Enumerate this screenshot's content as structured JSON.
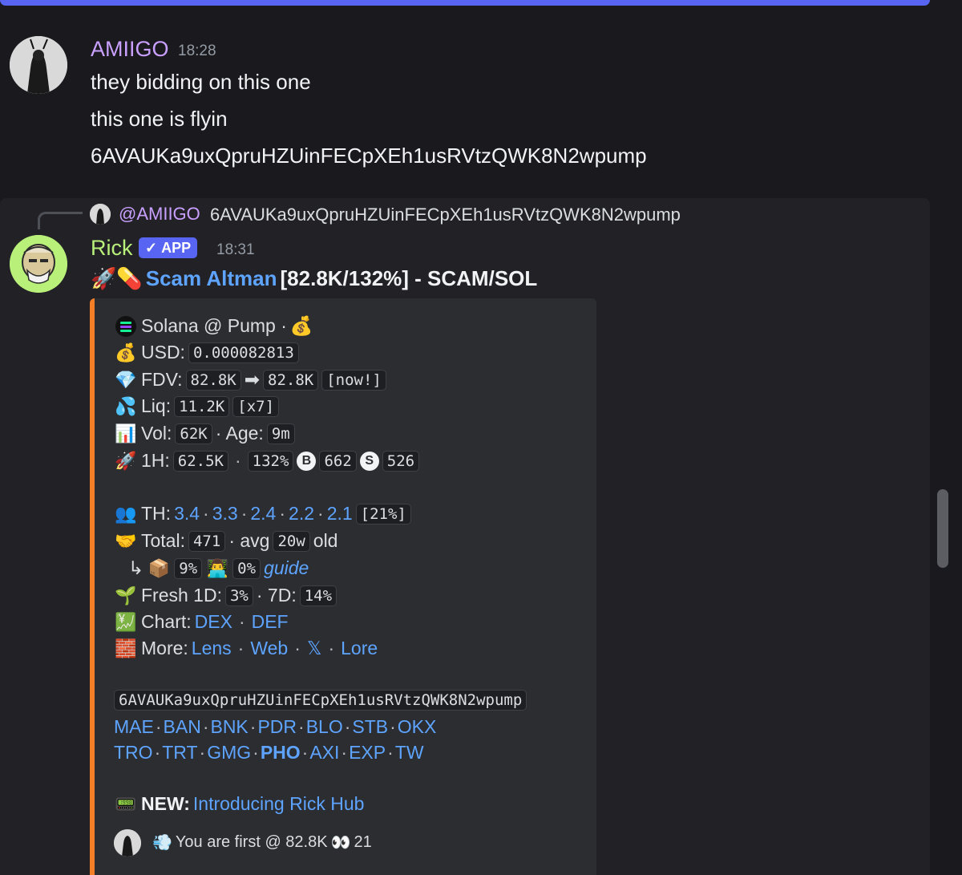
{
  "message1": {
    "username": "AMIIGO",
    "time": "18:28",
    "lines": [
      "they bidding on this one",
      "this one is flyin",
      "6AVAUKa9uxQpruHZUinFECpXEh1usRVtzQWK8N2wpump"
    ]
  },
  "reply": {
    "mention": "@AMIIGO",
    "text": "6AVAUKa9uxQpruHZUinFECpXEh1usRVtzQWK8N2wpump"
  },
  "message2": {
    "username": "Rick",
    "badge": "APP",
    "time": "18:31",
    "title_emoji": "🚀💊",
    "title_link": "Scam Altman",
    "title_rest": "[82.8K/132%] - SCAM/SOL"
  },
  "embed": {
    "chain": {
      "icon": "solana-icon",
      "text": "Solana @ Pump ·",
      "emoji": "💰"
    },
    "usd": {
      "label": "USD:",
      "value": "0.000082813"
    },
    "fdv": {
      "label": "FDV:",
      "from": "82.8K",
      "arrow": "➡",
      "to": "82.8K",
      "tag": "[now!]"
    },
    "liq": {
      "label": "Liq:",
      "value": "11.2K",
      "mult": "[x7]"
    },
    "vol": {
      "label": "Vol:",
      "value": "62K",
      "age_label": "· Age:",
      "age": "9m"
    },
    "h1": {
      "label": "1H:",
      "vol": "62.5K",
      "pct": "132%",
      "buy_badge": "B",
      "buys": "662",
      "sell_badge": "S",
      "sells": "526"
    },
    "th": {
      "label": "TH:",
      "values": [
        "3.4",
        "3.3",
        "2.4",
        "2.2",
        "2.1"
      ],
      "pct": "[21%]"
    },
    "total": {
      "label": "Total:",
      "value": "471",
      "avg_label": "· avg",
      "avg": "20w",
      "suffix": "old"
    },
    "sub": {
      "arrow": "↳",
      "box_pct": "9%",
      "dev_pct": "0%",
      "guide": "guide"
    },
    "fresh": {
      "label": "Fresh 1D:",
      "d1": "3%",
      "d7_label": "· 7D:",
      "d7": "14%"
    },
    "chart": {
      "label": "Chart:",
      "links": [
        "DEX",
        "DEF"
      ]
    },
    "more": {
      "label": "More:",
      "links": [
        "Lens",
        "Web",
        "𝕏",
        "Lore"
      ]
    },
    "address": "6AVAUKa9uxQpruHZUinFECpXEh1usRVtzQWK8N2wpump",
    "row1": [
      "MAE",
      "BAN",
      "BNK",
      "PDR",
      "BLO",
      "STB",
      "OKX"
    ],
    "row2": [
      "TRO",
      "TRT",
      "GMG",
      "PHO",
      "AXI",
      "EXP",
      "TW"
    ],
    "news": {
      "label": "NEW:",
      "link": "Introducing Rick Hub"
    },
    "footer": {
      "emoji": "💨",
      "text": "You are first @ 82.8K",
      "eyes": "👀",
      "count": "21"
    }
  },
  "colors": {
    "accent": "#5865f2",
    "embed_border": "#f57f26",
    "link": "#5ea4ff",
    "rick": "#b8f07a",
    "amiigo": "#c9a0ff"
  }
}
